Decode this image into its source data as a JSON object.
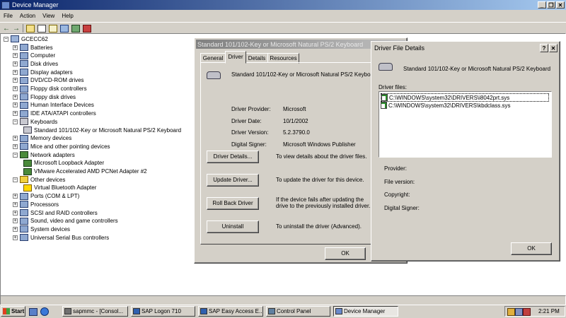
{
  "window": {
    "title": "Device Manager"
  },
  "menu": [
    "File",
    "Action",
    "View",
    "Help"
  ],
  "tree": {
    "root": "GCECC62",
    "items": [
      {
        "label": "Batteries",
        "icon": "battery-icon",
        "exp": "+"
      },
      {
        "label": "Computer",
        "icon": "computer-icon",
        "exp": "+"
      },
      {
        "label": "Disk drives",
        "icon": "disk-drive-icon",
        "exp": "+"
      },
      {
        "label": "Display adapters",
        "icon": "display-adapter-icon",
        "exp": "+"
      },
      {
        "label": "DVD/CD-ROM drives",
        "icon": "cdrom-icon",
        "exp": "+"
      },
      {
        "label": "Floppy disk controllers",
        "icon": "floppy-controller-icon",
        "exp": "+"
      },
      {
        "label": "Floppy disk drives",
        "icon": "floppy-drive-icon",
        "exp": "+"
      },
      {
        "label": "Human Interface Devices",
        "icon": "hid-icon",
        "exp": "+"
      },
      {
        "label": "IDE ATA/ATAPI controllers",
        "icon": "ide-controller-icon",
        "exp": "+"
      },
      {
        "label": "Keyboards",
        "icon": "keyboard-icon",
        "exp": "-"
      },
      {
        "label": "Standard 101/102-Key or Microsoft Natural PS/2 Keyboard",
        "icon": "keyboard-icon",
        "child": true
      },
      {
        "label": "Memory devices",
        "icon": "memory-icon",
        "exp": "+"
      },
      {
        "label": "Mice and other pointing devices",
        "icon": "mouse-icon",
        "exp": "+"
      },
      {
        "label": "Network adapters",
        "icon": "network-adapter-icon",
        "exp": "-"
      },
      {
        "label": "Microsoft Loopback Adapter",
        "icon": "network-adapter-icon",
        "child": true
      },
      {
        "label": "VMware Accelerated AMD PCNet Adapter #2",
        "icon": "network-adapter-icon",
        "child": true
      },
      {
        "label": "Other devices",
        "icon": "unknown-device-icon",
        "exp": "-"
      },
      {
        "label": "Virtual Bluetooth Adapter",
        "icon": "warning-icon",
        "child": true
      },
      {
        "label": "Ports (COM & LPT)",
        "icon": "port-icon",
        "exp": "+"
      },
      {
        "label": "Processors",
        "icon": "processor-icon",
        "exp": "+"
      },
      {
        "label": "SCSI and RAID controllers",
        "icon": "scsi-icon",
        "exp": "+"
      },
      {
        "label": "Sound, video and game controllers",
        "icon": "sound-icon",
        "exp": "+"
      },
      {
        "label": "System devices",
        "icon": "system-icon",
        "exp": "+"
      },
      {
        "label": "Universal Serial Bus controllers",
        "icon": "usb-icon",
        "exp": "+"
      }
    ]
  },
  "props": {
    "title": "Standard 101/102-Key or Microsoft Natural PS/2 Keyboard",
    "tabs": [
      "General",
      "Driver",
      "Details",
      "Resources"
    ],
    "device_name": "Standard 101/102-Key or Microsoft Natural PS/2 Keyboard",
    "fields": [
      {
        "label": "Driver Provider:",
        "value": "Microsoft"
      },
      {
        "label": "Driver Date:",
        "value": "10/1/2002"
      },
      {
        "label": "Driver Version:",
        "value": "5.2.3790.0"
      },
      {
        "label": "Digital Signer:",
        "value": "Microsoft Windows Publisher"
      }
    ],
    "actions": [
      {
        "button": "Driver Details...",
        "desc": "To view details about the driver files."
      },
      {
        "button": "Update Driver...",
        "desc": "To update the driver for this device."
      },
      {
        "button": "Roll Back Driver",
        "desc": "If the device fails after updating the drive to the previously installed driver."
      },
      {
        "button": "Uninstall",
        "desc": "To uninstall the driver (Advanced)."
      }
    ],
    "ok": "OK"
  },
  "dff": {
    "title": "Driver File Details",
    "device_name": "Standard 101/102-Key or Microsoft Natural PS/2 Keyboard",
    "files_label": "Driver files:",
    "files": [
      "C:\\WINDOWS\\system32\\DRIVERS\\i8042prt.sys",
      "C:\\WINDOWS\\system32\\DRIVERS\\kbdclass.sys"
    ],
    "info": [
      "Provider:",
      "File version:",
      "Copyright:",
      "Digital Signer:"
    ],
    "ok": "OK"
  },
  "taskbar": {
    "start": "Start",
    "tasks": [
      "sapmmc - [Consol...",
      "SAP Logon 710",
      "SAP Easy Access E...",
      "Control Panel",
      "Device Manager"
    ],
    "clock": "2:21 PM"
  },
  "colors": {
    "title_active": "#0a246a",
    "face": "#d4d0c8",
    "desktop_taskbar": "#d4d0c8"
  }
}
